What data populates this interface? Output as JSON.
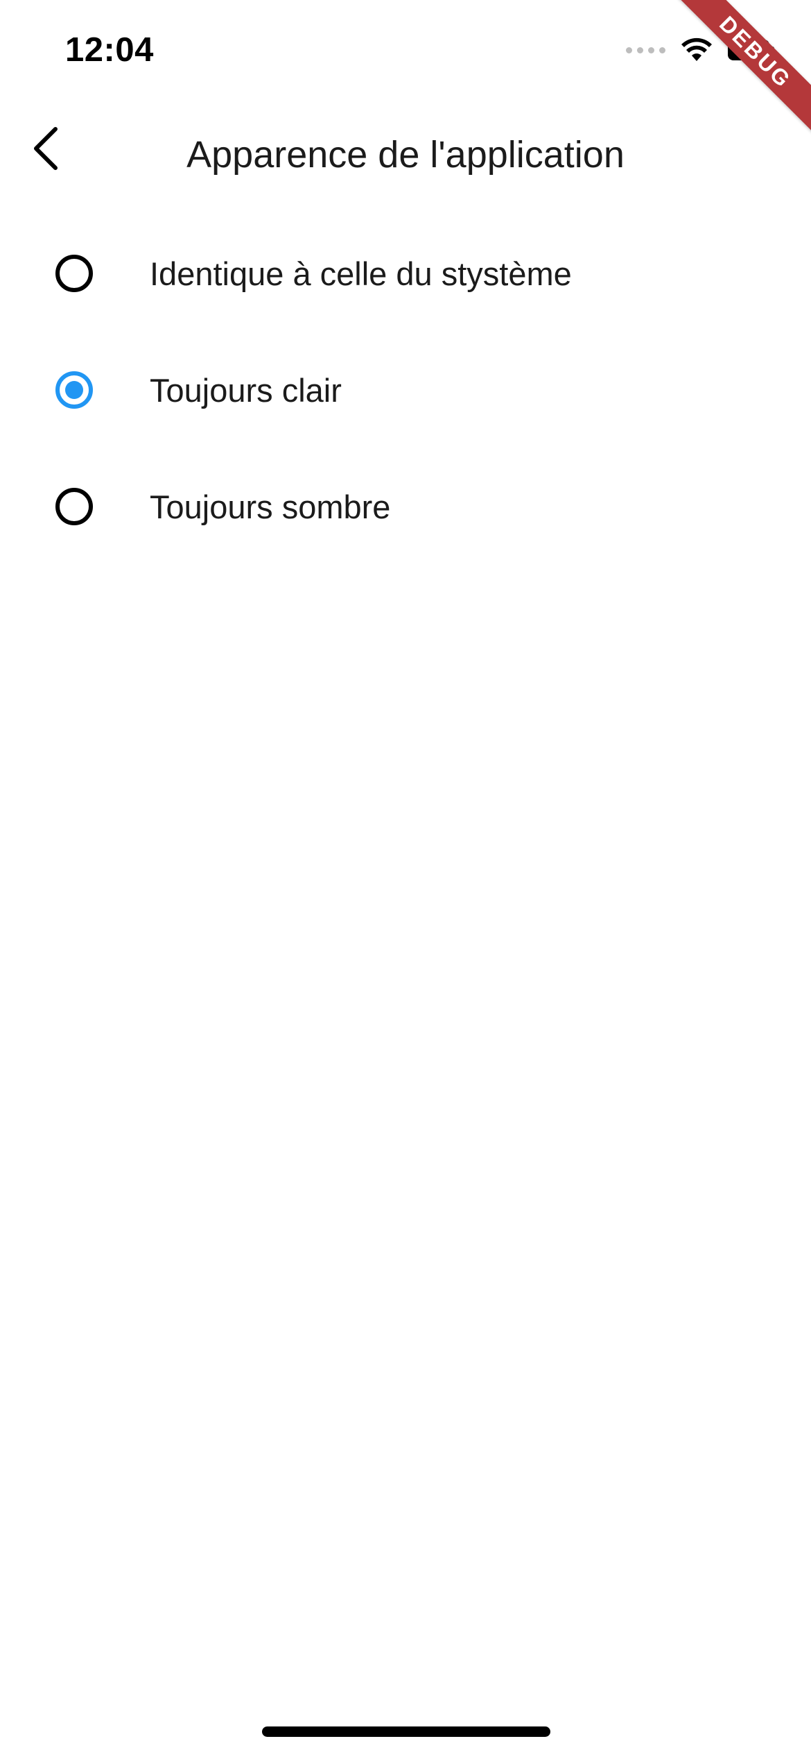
{
  "status_bar": {
    "time": "12:04"
  },
  "debug_banner": {
    "label": "DEBUG",
    "color": "#b4383a"
  },
  "app_bar": {
    "title": "Apparence de l'application",
    "back_icon": "chevron-left-icon"
  },
  "options": [
    {
      "label": "Identique à celle du stystème",
      "selected": false
    },
    {
      "label": "Toujours clair",
      "selected": true
    },
    {
      "label": "Toujours sombre",
      "selected": false
    }
  ],
  "colors": {
    "accent": "#2196f3",
    "text": "#1b1b1b",
    "background": "#ffffff"
  }
}
